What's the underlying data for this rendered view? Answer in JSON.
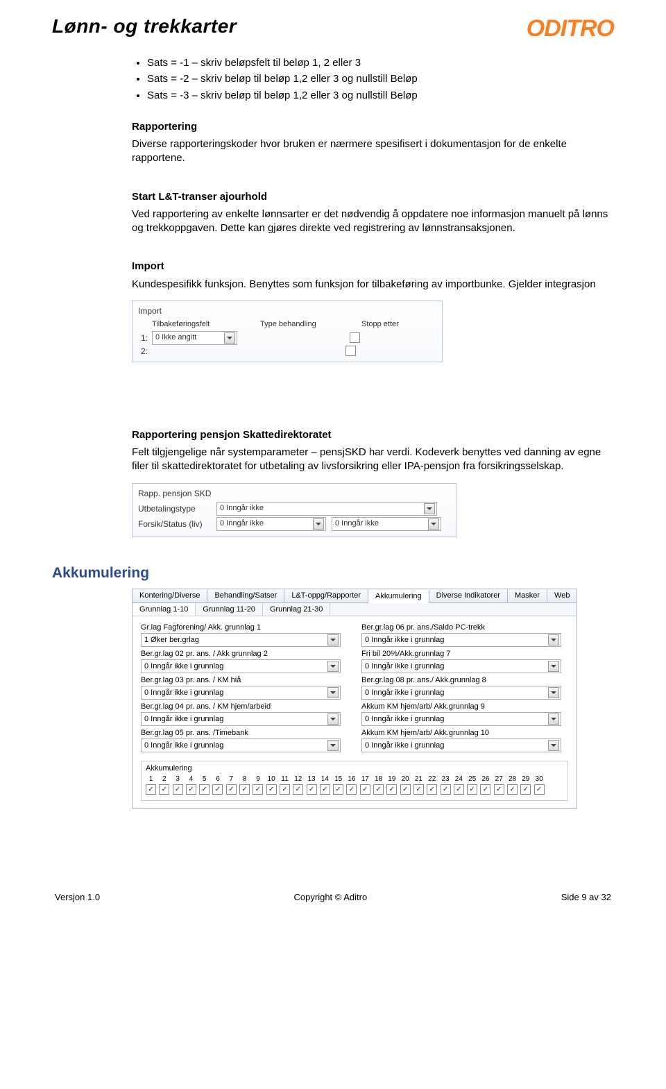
{
  "header": {
    "doc_title": "Lønn- og trekkarter",
    "logo_text": "ODITRO"
  },
  "bullets": [
    "Sats = -1 – skriv beløpsfelt til beløp 1, 2 eller 3",
    "Sats = -2 – skriv beløp til beløp 1,2 eller 3 og nullstill Beløp",
    "Sats = -3 – skriv beløp til beløp 1,2 eller 3 og nullstill Beløp"
  ],
  "rapportering": {
    "title": "Rapportering",
    "text": "Diverse rapporteringskoder hvor bruken er nærmere spesifisert i dokumentasjon for de enkelte rapportene."
  },
  "start_lt": {
    "title": "Start L&T-transer ajourhold",
    "text": "Ved rapportering av enkelte lønnsarter er det nødvendig å oppdatere noe informasjon manuelt på lønns og trekkoppgaven. Dette kan gjøres direkte ved registrering av lønnstransaksjonen."
  },
  "import": {
    "title": "Import",
    "text": "Kundespesifikk funksjon. Benyttes som funksjon for tilbakeføring av importbunke. Gjelder integrasjon",
    "panel_title": "Import",
    "col1": "Tilbakeføringsfelt",
    "col2": "Type behandling",
    "col3": "Stopp etter",
    "row1_num": "1:",
    "row2_num": "2:",
    "row1_val": "0 Ikke angitt"
  },
  "rapp_pensjon": {
    "title": "Rapportering pensjon Skattedirektoratet",
    "text": "Felt tilgjengelige når systemparameter – pensjSKD har verdi. Kodeverk benyttes ved danning av egne filer til skattedirektoratet for utbetaling av livsforsikring eller IPA-pensjon fra forsikringsselskap.",
    "panel_title": "Rapp. pensjon SKD",
    "row1_label": "Utbetalingstype",
    "row2_label": "Forsik/Status (liv)",
    "val_ingar": "0 Inngår ikke"
  },
  "akkumulering": {
    "title": "Akkumulering",
    "tabs": [
      "Kontering/Diverse",
      "Behandling/Satser",
      "L&T-oppg/Rapporter",
      "Akkumulering",
      "Diverse Indikatorer",
      "Masker",
      "Web"
    ],
    "active_tab": "Akkumulering",
    "sub_tabs": [
      "Grunnlag 1-10",
      "Grunnlag 11-20",
      "Grunnlag 21-30"
    ],
    "active_sub": "Grunnlag 1-10",
    "rows": [
      {
        "l_label": "Gr.lag Fagforening/ Akk. grunnlag 1",
        "l_val": "1 Øker ber.grlag",
        "r_label": "Ber.gr.lag 06 pr. ans./Saldo PC-trekk",
        "r_val": "0 Inngår ikke i grunnlag"
      },
      {
        "l_label": "Ber.gr.lag 02 pr. ans. / Akk grunnlag 2",
        "l_val": "0 Inngår ikke i grunnlag",
        "r_label": "Fri bil 20%/Akk.grunnlag 7",
        "r_val": "0 Inngår ikke i grunnlag"
      },
      {
        "l_label": "Ber.gr.lag 03 pr. ans. / KM hiå",
        "l_val": "0 Inngår ikke i grunnlag",
        "r_label": "Ber.gr.lag 08 pr. ans./ Akk.grunnlag 8",
        "r_val": "0 Inngår ikke i grunnlag"
      },
      {
        "l_label": "Ber.gr.lag 04 pr. ans. / KM hjem/arbeid",
        "l_val": "0 Inngår ikke i grunnlag",
        "r_label": "Akkum KM hjem/arb/ Akk.grunnlag 9",
        "r_val": "0 Inngår ikke i grunnlag"
      },
      {
        "l_label": "Ber.gr.lag 05 pr. ans. /Timebank",
        "l_val": "0 Inngår ikke i grunnlag",
        "r_label": "Akkum KM hjem/arb/ Akk.grunnlag 10",
        "r_val": "0 Inngår ikke i grunnlag"
      }
    ],
    "akk_box_title": "Akkumulering",
    "nums": [
      "1",
      "2",
      "3",
      "4",
      "5",
      "6",
      "7",
      "8",
      "9",
      "10",
      "11",
      "12",
      "13",
      "14",
      "15",
      "16",
      "17",
      "18",
      "19",
      "20",
      "21",
      "22",
      "23",
      "24",
      "25",
      "26",
      "27",
      "28",
      "29",
      "30"
    ]
  },
  "footer": {
    "left": "Versjon 1.0",
    "center": "Copyright © Aditro",
    "right": "Side 9 av 32"
  }
}
